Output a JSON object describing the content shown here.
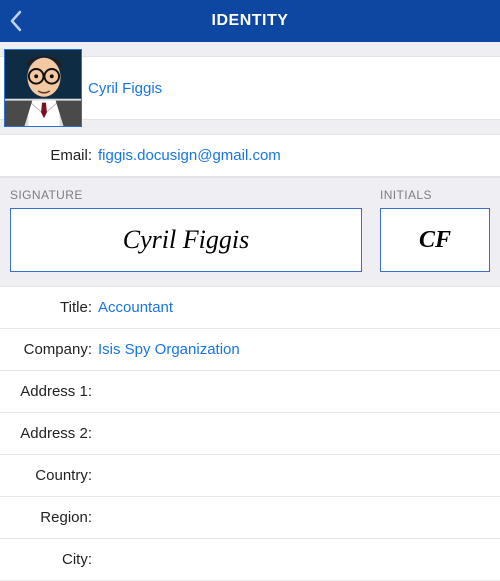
{
  "header": {
    "title": "IDENTITY"
  },
  "profile": {
    "name": "Cyril Figgis",
    "email_label": "Email:",
    "email": "figgis.docusign@gmail.com"
  },
  "signature": {
    "signature_label": "SIGNATURE",
    "signature_value": "Cyril Figgis",
    "initials_label": "INITIALS",
    "initials_value": "CF"
  },
  "fields": [
    {
      "label": "Title:",
      "value": "Accountant"
    },
    {
      "label": "Company:",
      "value": "Isis Spy Organization"
    },
    {
      "label": "Address 1:",
      "value": ""
    },
    {
      "label": "Address 2:",
      "value": ""
    },
    {
      "label": "Country:",
      "value": ""
    },
    {
      "label": "Region:",
      "value": ""
    },
    {
      "label": "City:",
      "value": ""
    }
  ]
}
